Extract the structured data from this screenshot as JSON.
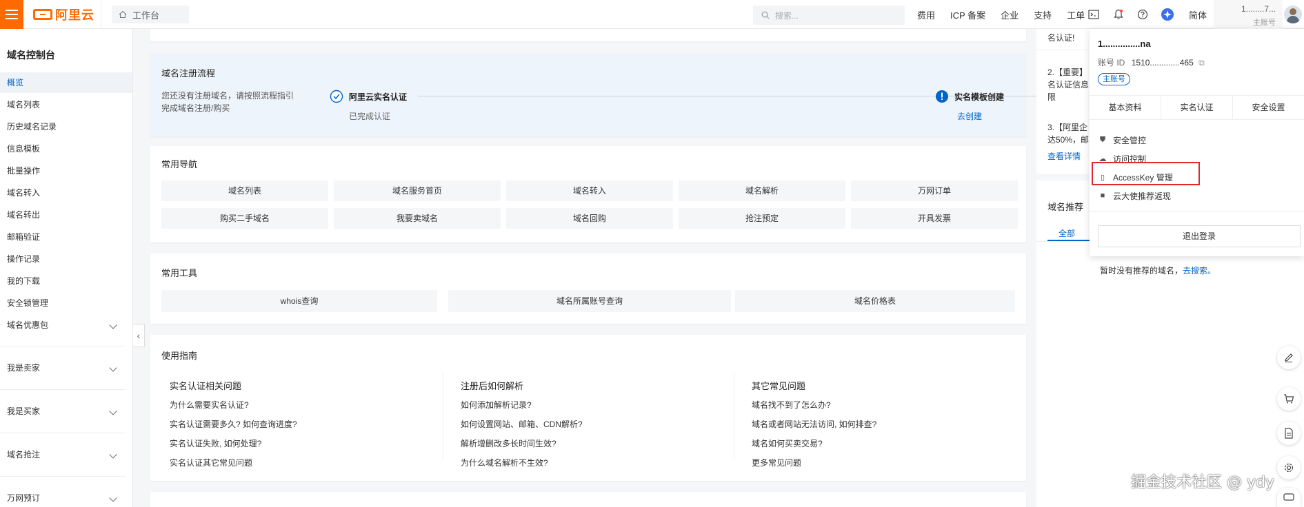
{
  "brand": {
    "name": "阿里云",
    "accent": "#ff6a00",
    "link": "#0064c8"
  },
  "topbar": {
    "workbench": "工作台",
    "search_placeholder": "搜索...",
    "links": [
      "费用",
      "ICP 备案",
      "企业",
      "支持",
      "工单"
    ],
    "lang": "简体",
    "account_name": "1........7...",
    "account_type": "主账号"
  },
  "sidebar": {
    "title": "域名控制台",
    "items": [
      "概览",
      "域名列表",
      "历史域名记录",
      "信息模板",
      "批量操作",
      "域名转入",
      "域名转出",
      "邮箱验证",
      "操作记录",
      "我的下载",
      "安全锁管理",
      "域名优惠包"
    ],
    "groups": [
      "我是卖家",
      "我是买家",
      "域名抢注",
      "万网预订"
    ]
  },
  "process": {
    "title": "域名注册流程",
    "desc_line1": "您还没有注册域名，请按照流程指引",
    "desc_line2": "完成域名注册/购买",
    "step1_title": "阿里云实名认证",
    "step1_sub": "已完成认证",
    "step2_title": "实名模板创建",
    "step2_link": "去创建"
  },
  "nav": {
    "title": "常用导航",
    "row1": [
      "域名列表",
      "域名服务首页",
      "域名转入",
      "域名解析",
      "万网订单"
    ],
    "row2": [
      "购买二手域名",
      "我要卖域名",
      "域名回购",
      "抢注预定",
      "开具发票"
    ]
  },
  "tools": {
    "title": "常用工具",
    "items": [
      "whois查询",
      "域名所属账号查询",
      "域名价格表"
    ]
  },
  "guide": {
    "title": "使用指南",
    "cols": [
      {
        "title": "实名认证相关问题",
        "items": [
          "为什么需要实名认证?",
          "实名认证需要多久? 如何查询进度?",
          "实名认证失败, 如何处理?",
          "实名认证其它常见问题"
        ]
      },
      {
        "title": "注册后如何解析",
        "items": [
          "如何添加解析记录?",
          "如何设置网站、邮箱、CDN解析?",
          "解析增删改多长时间生效?",
          "为什么域名解析不生效?"
        ]
      },
      {
        "title": "其它常见问题",
        "items": [
          "域名找不到了怎么办?",
          "域名或者网站无法访问, 如何排查?",
          "域名如何买卖交易?",
          "更多常见问题"
        ]
      }
    ]
  },
  "notices": {
    "l1": "名认证!",
    "l2a": "2.【重要】",
    "l2b": "名认证信息",
    "l2c": "限",
    "l3a": "3.【阿里企",
    "l3b": "达50%，邮",
    "more": "查看详情"
  },
  "recommend": {
    "title": "域名推荐",
    "tab": "全部",
    "empty": "暂时没有推荐的域名，",
    "empty_link": "去搜索。"
  },
  "dropdown": {
    "name": "1...............na",
    "id_label": "账号 ID",
    "id_value": "1510.............465",
    "badge": "主账号",
    "tabs": [
      "基本资料",
      "实名认证",
      "安全设置"
    ],
    "menu": [
      "安全管控",
      "访问控制",
      "AccessKey 管理",
      "云大使推荐返现"
    ],
    "logout": "退出登录"
  },
  "watermark": "掘金技术社区 @ ydy"
}
